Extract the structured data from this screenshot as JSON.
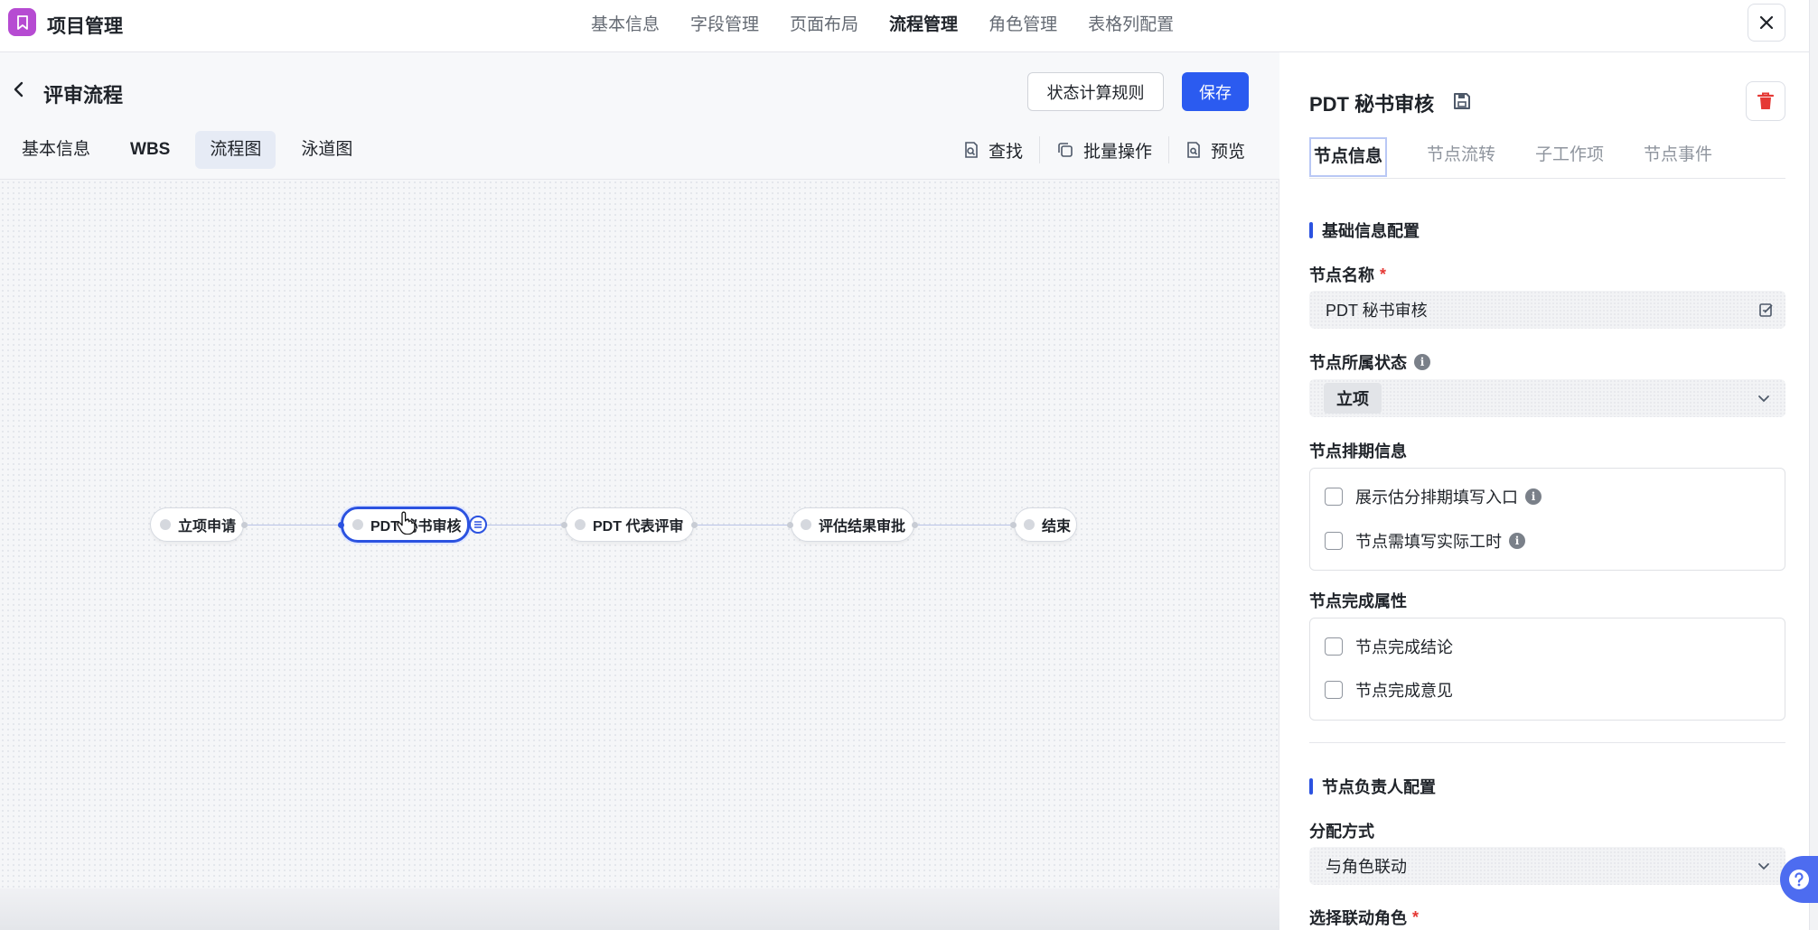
{
  "app": {
    "title": "项目管理"
  },
  "top_nav": [
    "基本信息",
    "字段管理",
    "页面布局",
    "流程管理",
    "角色管理",
    "表格列配置"
  ],
  "top_nav_active": "流程管理",
  "page": {
    "title": "评审流程",
    "rules_button": "状态计算规则",
    "save_button": "保存"
  },
  "sub_tabs": [
    "基本信息",
    "WBS",
    "流程图",
    "泳道图"
  ],
  "sub_tab_active": "流程图",
  "tools": {
    "find": "查找",
    "batch": "批量操作",
    "preview": "预览"
  },
  "flow": {
    "nodes": [
      "立项申请",
      "PDT 秘书审核",
      "PDT 代表评审",
      "评估结果审批",
      "结束"
    ],
    "selected": "PDT 秘书审核"
  },
  "panel": {
    "title": "PDT 秘书审核",
    "tabs": [
      "节点信息",
      "节点流转",
      "子工作项",
      "节点事件"
    ],
    "tab_active": "节点信息",
    "basic_section": "基础信息配置",
    "name_label": "节点名称",
    "name_value": "PDT 秘书审核",
    "status_label": "节点所属状态",
    "status_value": "立项",
    "schedule_label": "节点排期信息",
    "schedule_options": [
      "展示估分排期填写入口",
      "节点需填写实际工时"
    ],
    "complete_label": "节点完成属性",
    "complete_options": [
      "节点完成结论",
      "节点完成意见"
    ],
    "owner_section": "节点负责人配置",
    "assign_label": "分配方式",
    "assign_value": "与角色联动",
    "role_label": "选择联动角色",
    "required_mark": "*"
  },
  "colors": {
    "primary": "#2b5bf0",
    "brand_icon": "#b64bd2",
    "delete": "#e53935"
  }
}
